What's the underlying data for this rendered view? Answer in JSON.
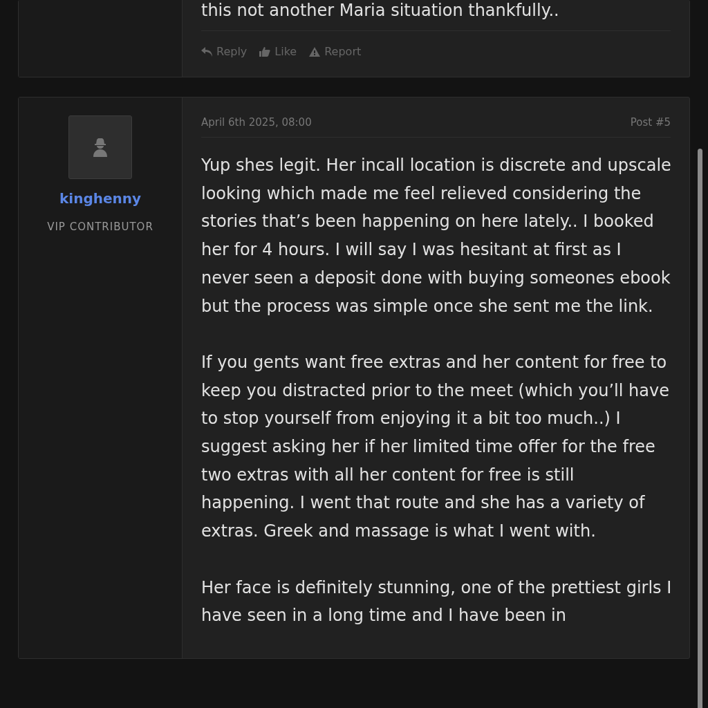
{
  "posts": [
    {
      "paragraphs": [
        "this not another Maria situation thankfully.."
      ],
      "actions": [
        {
          "kind": "reply",
          "label": "Reply"
        },
        {
          "kind": "like",
          "label": "Like"
        },
        {
          "kind": "report",
          "label": "Report"
        }
      ]
    },
    {
      "author": {
        "name": "kinghenny",
        "role": "VIP CONTRIBUTOR"
      },
      "date": "April 6th 2025, 08:00",
      "number": "Post #5",
      "paragraphs": [
        "Yup shes legit. Her incall location is discrete and upscale looking which made me feel relieved considering the stories that’s been happening on here lately.. I booked her for 4 hours. I will say I was hesitant at first as I never seen a deposit done with buying someones ebook but the process was simple once she sent me the link.",
        "If you gents want free extras and her content for free to keep you distracted prior to the meet (which you’ll have to stop yourself from enjoying it a bit too much..) I suggest asking her if her limited time offer for the free two extras with all her content for free is still happening. I went that route and she has a variety of extras. Greek and massage is what I went with.",
        "Her face is definitely stunning, one of the prettiest girls I have seen in a long time and I have been in"
      ]
    }
  ]
}
